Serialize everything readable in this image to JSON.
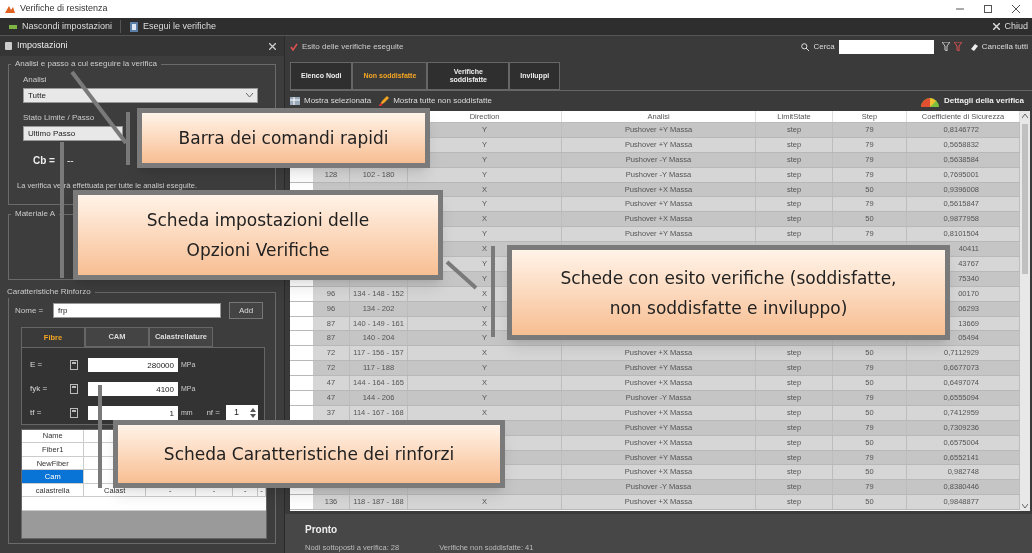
{
  "window": {
    "title": "Verifiche di resistenza"
  },
  "toolbar": {
    "items": [
      {
        "label": "Nascondi impostazioni",
        "kind": "hide"
      },
      {
        "label": "Esegui le verifiche",
        "kind": "run"
      }
    ],
    "close": "Chiud"
  },
  "settings": {
    "title": "Impostazioni",
    "analysis_group": {
      "title": "Analisi e passo a cui eseguire la verifica",
      "analysis_label": "Analisi",
      "analysis_value": "Tutte",
      "state_label": "Stato Limite / Passo",
      "state_value": "Ultimo Passo",
      "cb_label": "Cb =",
      "cb_value": "--",
      "note": "La verifica verrà effettuata per tutte le analisi eseguite."
    },
    "material_group": {
      "title": "Materiale A"
    },
    "reinforcement_group": {
      "title": "Caratteristiche Rinforzo",
      "name_label": "Nome =",
      "name_value": "frp",
      "add_button": "Add",
      "tabs": [
        {
          "label": "Fibre",
          "selected": true
        },
        {
          "label": "CAM",
          "selected": false
        },
        {
          "label": "Calastrellature",
          "selected": false
        }
      ],
      "fields": [
        {
          "label": "E =",
          "value": "280000",
          "unit": "MPa"
        },
        {
          "label": "fyk =",
          "value": "4100",
          "unit": "MPa"
        },
        {
          "label": "tf =",
          "value": "1",
          "unit": "mm"
        }
      ],
      "nf_label": "nf =",
      "nf_value": "1",
      "table": {
        "columns": [
          "Name",
          null,
          null,
          null,
          null,
          null
        ],
        "rows": [
          {
            "cells": [
              "Fiber1",
              null,
              null,
              null,
              null,
              null
            ],
            "selected": false
          },
          {
            "cells": [
              "NewFiber",
              null,
              null,
              null,
              null,
              null
            ],
            "selected": false
          },
          {
            "cells": [
              "Cam",
              null,
              null,
              null,
              null,
              null
            ],
            "selected": true
          },
          {
            "cells": [
              "calastrella",
              "Calast",
              "-",
              "-",
              "-",
              "-"
            ],
            "selected": false
          }
        ]
      }
    }
  },
  "results": {
    "title": "Esito delle verifiche eseguite",
    "search_label": "Cerca",
    "clear_all": "Cancella tutti",
    "tabs": [
      {
        "label": "Elenco Nodi",
        "selected": false
      },
      {
        "label": "Non soddisfatte",
        "selected": true
      },
      {
        "label": "Verifiche soddisfatte",
        "selected": false
      },
      {
        "label": "Inviluppi",
        "selected": false
      }
    ],
    "actions": [
      {
        "label": "Mostra selezionata",
        "kind": "show"
      },
      {
        "label": "Mostra tutte non soddisfatte",
        "kind": "showall"
      }
    ],
    "details": "Dettagli della verifica",
    "table": {
      "columns": [
        null,
        null,
        "Direction",
        "Analisi",
        "LimitState",
        "Step",
        "Coefficiente di Sicurezza"
      ],
      "rows": [
        [
          null,
          null,
          "Y",
          "Pushover +Y Massa",
          "step",
          "79",
          "0,8146772"
        ],
        [
          null,
          null,
          "Y",
          "Pushover +Y Massa",
          "step",
          "79",
          "0,5658832"
        ],
        [
          null,
          null,
          "Y",
          "Pushover -Y Massa",
          "step",
          "79",
          "0,5638584"
        ],
        [
          "128",
          "102 - 180",
          "Y",
          "Pushover -Y Massa",
          "step",
          "79",
          "0,7695001"
        ],
        [
          null,
          null,
          "X",
          "Pushover +X Massa",
          "step",
          "50",
          "0,9396008"
        ],
        [
          null,
          null,
          "Y",
          "Pushover +Y Massa",
          "step",
          "79",
          "0,5615847"
        ],
        [
          null,
          null,
          "X",
          "Pushover +X Massa",
          "step",
          "50",
          "0,9877958"
        ],
        [
          null,
          null,
          "Y",
          "Pushover +Y Massa",
          "step",
          "79",
          "0,8101504"
        ],
        [
          null,
          null,
          "X",
          null,
          null,
          null,
          "40411"
        ],
        [
          null,
          null,
          "Y",
          null,
          null,
          null,
          "43767"
        ],
        [
          null,
          null,
          "Y",
          null,
          null,
          null,
          "75340"
        ],
        [
          "96",
          "134 - 148 - 152",
          "X",
          null,
          null,
          null,
          "00170"
        ],
        [
          "96",
          "134 - 202",
          "Y",
          null,
          null,
          null,
          "06293"
        ],
        [
          "87",
          "140 - 149 - 161",
          "X",
          null,
          null,
          null,
          "13669"
        ],
        [
          "87",
          "140 - 204",
          "Y",
          null,
          null,
          null,
          "05494"
        ],
        [
          "72",
          "117 - 156 - 157",
          "X",
          "Pushover +X Massa",
          "step",
          "50",
          "0,7112929"
        ],
        [
          "72",
          "117 - 188",
          "Y",
          "Pushover +Y Massa",
          "step",
          "79",
          "0,6677073"
        ],
        [
          "47",
          "144 - 164 - 165",
          "X",
          "Pushover +X Massa",
          "step",
          "50",
          "0,6497074"
        ],
        [
          "47",
          "144 - 206",
          "Y",
          "Pushover -Y Massa",
          "step",
          "79",
          "0,6555094"
        ],
        [
          "37",
          "114 - 167 - 168",
          "X",
          "Pushover +X Massa",
          "step",
          "50",
          "0,7412959"
        ],
        [
          null,
          null,
          null,
          "Pushover +Y Massa",
          "step",
          "79",
          "0,7309236"
        ],
        [
          null,
          null,
          null,
          "Pushover +X Massa",
          "step",
          "50",
          "0,6575004"
        ],
        [
          null,
          null,
          null,
          "Pushover +Y Massa",
          "step",
          "79",
          "0,6552141"
        ],
        [
          null,
          null,
          null,
          "Pushover +X Massa",
          "step",
          "50",
          "0,982748"
        ],
        [
          null,
          null,
          null,
          "Pushover -Y Massa",
          "step",
          "79",
          "0,8380446"
        ],
        [
          "136",
          "118 - 187 - 188",
          "X",
          "Pushover +X Massa",
          "step",
          "50",
          "0,9848877"
        ]
      ]
    }
  },
  "status": {
    "state": "Pronto",
    "nodes": "Nodi sottoposti a verifica: 28",
    "failed": "Verifiche non soddisfatte: 41"
  },
  "callouts": [
    {
      "lines": [
        "Barra dei comandi rapidi"
      ]
    },
    {
      "lines": [
        "Scheda impostazioni delle",
        "Opzioni Verifiche"
      ]
    },
    {
      "lines": [
        "Schede con esito verifiche (soddisfatte,",
        "non soddisfatte e inviluppo)"
      ]
    },
    {
      "lines": [
        "Scheda Caratteristiche dei rinforzi"
      ]
    }
  ]
}
